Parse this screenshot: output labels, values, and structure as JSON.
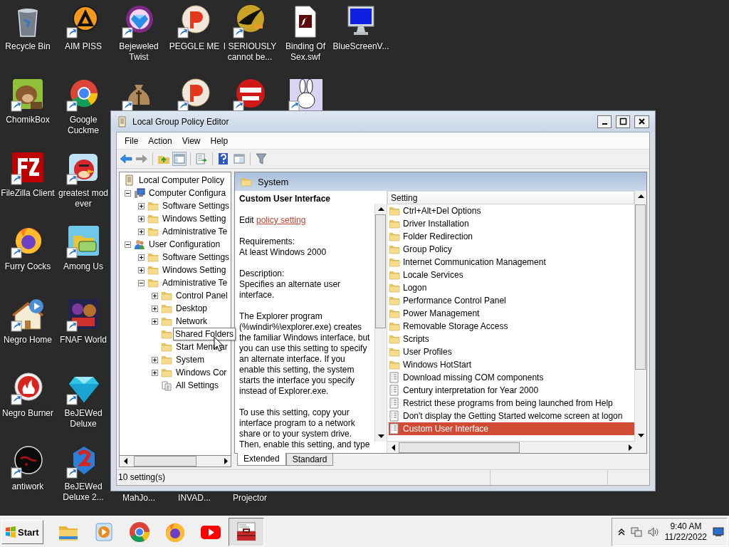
{
  "desktop_icons": [
    {
      "label": "Recycle Bin"
    },
    {
      "label": "AIM PISS"
    },
    {
      "label": "Bejeweled Twist"
    },
    {
      "label": "PEGGLE ME"
    },
    {
      "label": "I SERIOUSLY cannot be..."
    },
    {
      "label": "Binding Of Sex.swf"
    },
    {
      "label": "BlueScreenV..."
    },
    {
      "label": "ChomikBox"
    },
    {
      "label": "Google Cuckme"
    },
    {
      "label": "FileZilla Client"
    },
    {
      "label": "greatest mod ever"
    },
    {
      "label": "Furry Cocks"
    },
    {
      "label": "Among Us"
    },
    {
      "label": "Negro Home"
    },
    {
      "label": "FNAF World"
    },
    {
      "label": "Negro Burner"
    },
    {
      "label": "BeJEWed Deluxe"
    },
    {
      "label": "antiwork"
    },
    {
      "label": "BeJEWed Deluxe 2..."
    },
    {
      "label": "MahJo..."
    },
    {
      "label": "INVAD..."
    },
    {
      "label": "Projector"
    }
  ],
  "window": {
    "title": "Local Group Policy Editor",
    "menu": [
      "File",
      "Action",
      "View",
      "Help"
    ],
    "tree": {
      "label": "Local Computer Policy",
      "kind": "policy",
      "children": [
        {
          "label": "Computer Configura",
          "kind": "computer",
          "expanded": true,
          "children": [
            {
              "label": "Software Settings",
              "kind": "folder",
              "expanded": false
            },
            {
              "label": "Windows Setting",
              "kind": "folder",
              "expanded": false
            },
            {
              "label": "Administrative Te",
              "kind": "folder",
              "expanded": false
            }
          ]
        },
        {
          "label": "User Configuration",
          "kind": "users",
          "expanded": true,
          "children": [
            {
              "label": "Software Settings",
              "kind": "folder",
              "expanded": false
            },
            {
              "label": "Windows Setting",
              "kind": "folder",
              "expanded": false
            },
            {
              "label": "Administrative Te",
              "kind": "folder",
              "expanded": true,
              "children": [
                {
                  "label": "Control Panel",
                  "kind": "folder",
                  "expanded": false
                },
                {
                  "label": "Desktop",
                  "kind": "folder",
                  "expanded": false
                },
                {
                  "label": "Network",
                  "kind": "folder",
                  "expanded": false
                },
                {
                  "label": "Shared Folders",
                  "kind": "folder",
                  "tooltip": true
                },
                {
                  "label": "Start Menu ar",
                  "kind": "folder"
                },
                {
                  "label": "System",
                  "kind": "folder",
                  "expanded": false
                },
                {
                  "label": "Windows Cor",
                  "kind": "folder",
                  "expanded": false
                },
                {
                  "label": "All Settings",
                  "kind": "settings"
                }
              ]
            }
          ]
        }
      ]
    },
    "header": "System",
    "details": {
      "title": "Custom User Interface",
      "edit_prefix": "Edit",
      "edit_link": "policy setting",
      "requirements_label": "Requirements:",
      "requirements": "At least Windows 2000",
      "description_label": "Description:",
      "paragraphs": [
        "Specifies an alternate user interface.",
        "The Explorer program (%windir%\\explorer.exe) creates the familiar Windows interface, but you can use this setting to specify an alternate interface. If you enable this setting, the system starts the interface you specify instead of Explorer.exe.",
        "To use this setting, copy your interface program to a network share or to your system drive. Then, enable this setting, and type"
      ]
    },
    "list": {
      "column": "Setting",
      "rows": [
        {
          "name": "Ctrl+Alt+Del Options",
          "kind": "folder",
          "selected": false
        },
        {
          "name": "Driver Installation",
          "kind": "folder",
          "selected": false
        },
        {
          "name": "Folder Redirection",
          "kind": "folder",
          "selected": false
        },
        {
          "name": "Group Policy",
          "kind": "folder",
          "selected": false
        },
        {
          "name": "Internet Communication Management",
          "kind": "folder",
          "selected": false
        },
        {
          "name": "Locale Services",
          "kind": "folder",
          "selected": false
        },
        {
          "name": "Logon",
          "kind": "folder",
          "selected": false
        },
        {
          "name": "Performance Control Panel",
          "kind": "folder",
          "selected": false
        },
        {
          "name": "Power Management",
          "kind": "folder",
          "selected": false
        },
        {
          "name": "Removable Storage Access",
          "kind": "folder",
          "selected": false
        },
        {
          "name": "Scripts",
          "kind": "folder",
          "selected": false
        },
        {
          "name": "User Profiles",
          "kind": "folder",
          "selected": false
        },
        {
          "name": "Windows HotStart",
          "kind": "folder",
          "selected": false
        },
        {
          "name": "Download missing COM components",
          "kind": "setting",
          "selected": false
        },
        {
          "name": "Century interpretation for Year 2000",
          "kind": "setting",
          "selected": false
        },
        {
          "name": "Restrict these programs from being launched from Help",
          "kind": "setting",
          "selected": false
        },
        {
          "name": "Don't display the Getting Started welcome screen at logon",
          "kind": "setting",
          "selected": false
        },
        {
          "name": "Custom User Interface",
          "kind": "setting",
          "selected": true
        }
      ]
    },
    "tabs": [
      {
        "label": "Extended",
        "selected": true
      },
      {
        "label": "Standard",
        "selected": false
      }
    ],
    "status": "10 setting(s)"
  },
  "taskbar": {
    "start": "Start",
    "apps": [
      {
        "active": false
      },
      {
        "active": false
      },
      {
        "active": false
      },
      {
        "active": false
      },
      {
        "active": false
      },
      {
        "active": true
      }
    ],
    "time": "9:40 AM",
    "date": "11/22/2022"
  }
}
